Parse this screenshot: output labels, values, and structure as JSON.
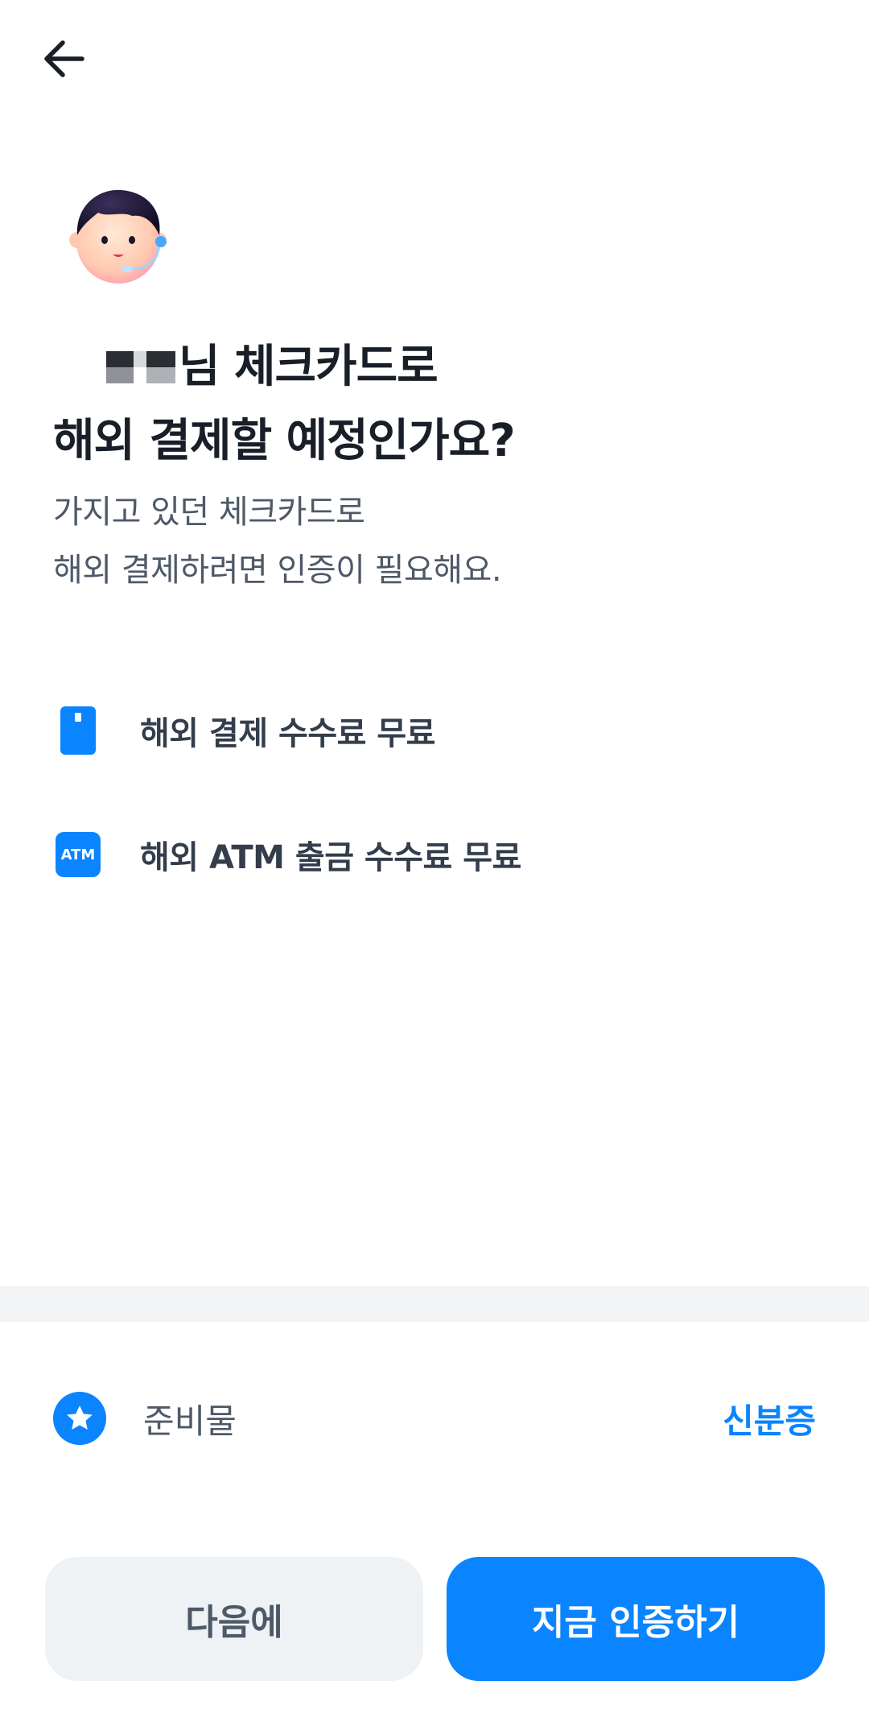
{
  "nav": {
    "back_icon": "arrow-left-icon"
  },
  "avatar": {
    "icon": "customer-service-agent-avatar"
  },
  "title": {
    "line1_suffix": "님 체크카드로",
    "line2": "해외 결제할 예정인가요?"
  },
  "subtitle": {
    "line1": "가지고 있던 체크카드로",
    "line2": "해외 결제하려면 인증이 필요해요."
  },
  "benefits": [
    {
      "icon": "card-icon",
      "label": "해외 결제 수수료 무료"
    },
    {
      "icon": "atm-icon",
      "icon_text": "ATM",
      "label": "해외 ATM 출금 수수료 무료"
    }
  ],
  "preparation": {
    "icon": "star-icon",
    "label": "준비물",
    "value": "신분증"
  },
  "buttons": {
    "later": "다음에",
    "verify_now": "지금 인증하기"
  },
  "colors": {
    "accent": "#0a84ff",
    "text_primary": "#191f28",
    "text_secondary": "#4e5968",
    "divider": "#f2f4f6"
  }
}
